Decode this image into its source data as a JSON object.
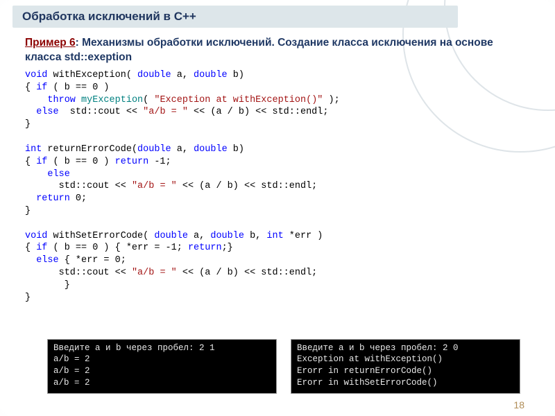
{
  "title": "Обработка исключений в С++",
  "example_label": "Пример 6",
  "subtitle_rest": ": Механизмы обработки исключений. Создание класса исключения на основе класса std::exeption",
  "code": {
    "l1a": "void",
    "l1b": " withException( ",
    "l1c": "double",
    "l1d": " a, ",
    "l1e": "double",
    "l1f": " b)",
    "l2a": "{ ",
    "l2b": "if",
    "l2c": " ( b == 0 )",
    "l3a": "    ",
    "l3b": "throw",
    "l3c": " ",
    "l3d": "myException",
    "l3e": "( ",
    "l3f": "\"Exception at withException()\"",
    "l3g": " );",
    "l4a": "  ",
    "l4b": "else",
    "l4c": "  std::cout << ",
    "l4d": "\"a/b = \"",
    "l4e": " << (a / b) << std::endl;",
    "l5": "}",
    "l7a": "int",
    "l7b": " returnErrorCode(",
    "l7c": "double",
    "l7d": " a, ",
    "l7e": "double",
    "l7f": " b)",
    "l8a": "{ ",
    "l8b": "if",
    "l8c": " ( b == 0 ) ",
    "l8d": "return",
    "l8e": " -1;",
    "l9a": "    ",
    "l9b": "else",
    "l10a": "      std::cout << ",
    "l10b": "\"a/b = \"",
    "l10c": " << (a / b) << std::endl;",
    "l11a": "  ",
    "l11b": "return",
    "l11c": " 0;",
    "l12": "}",
    "l14a": "void",
    "l14b": " withSetErrorCode( ",
    "l14c": "double",
    "l14d": " a, ",
    "l14e": "double",
    "l14f": " b, ",
    "l14g": "int",
    "l14h": " *err )",
    "l15a": "{ ",
    "l15b": "if",
    "l15c": " ( b == 0 ) { *err = -1; ",
    "l15d": "return",
    "l15e": ";}",
    "l16a": "  ",
    "l16b": "else",
    "l16c": " { *err = 0;",
    "l17a": "      std::cout << ",
    "l17b": "\"a/b = \"",
    "l17c": " << (a / b) << std::endl;",
    "l18": "       }",
    "l19": "}"
  },
  "console1": "Введите a и b через пробел: 2 1\na/b = 2\na/b = 2\na/b = 2",
  "console2": "Введите a и b через пробел: 2 0\nException at withException()\nErorr in returnErrorCode()\nErorr in withSetErrorCode()",
  "page_number": "18"
}
